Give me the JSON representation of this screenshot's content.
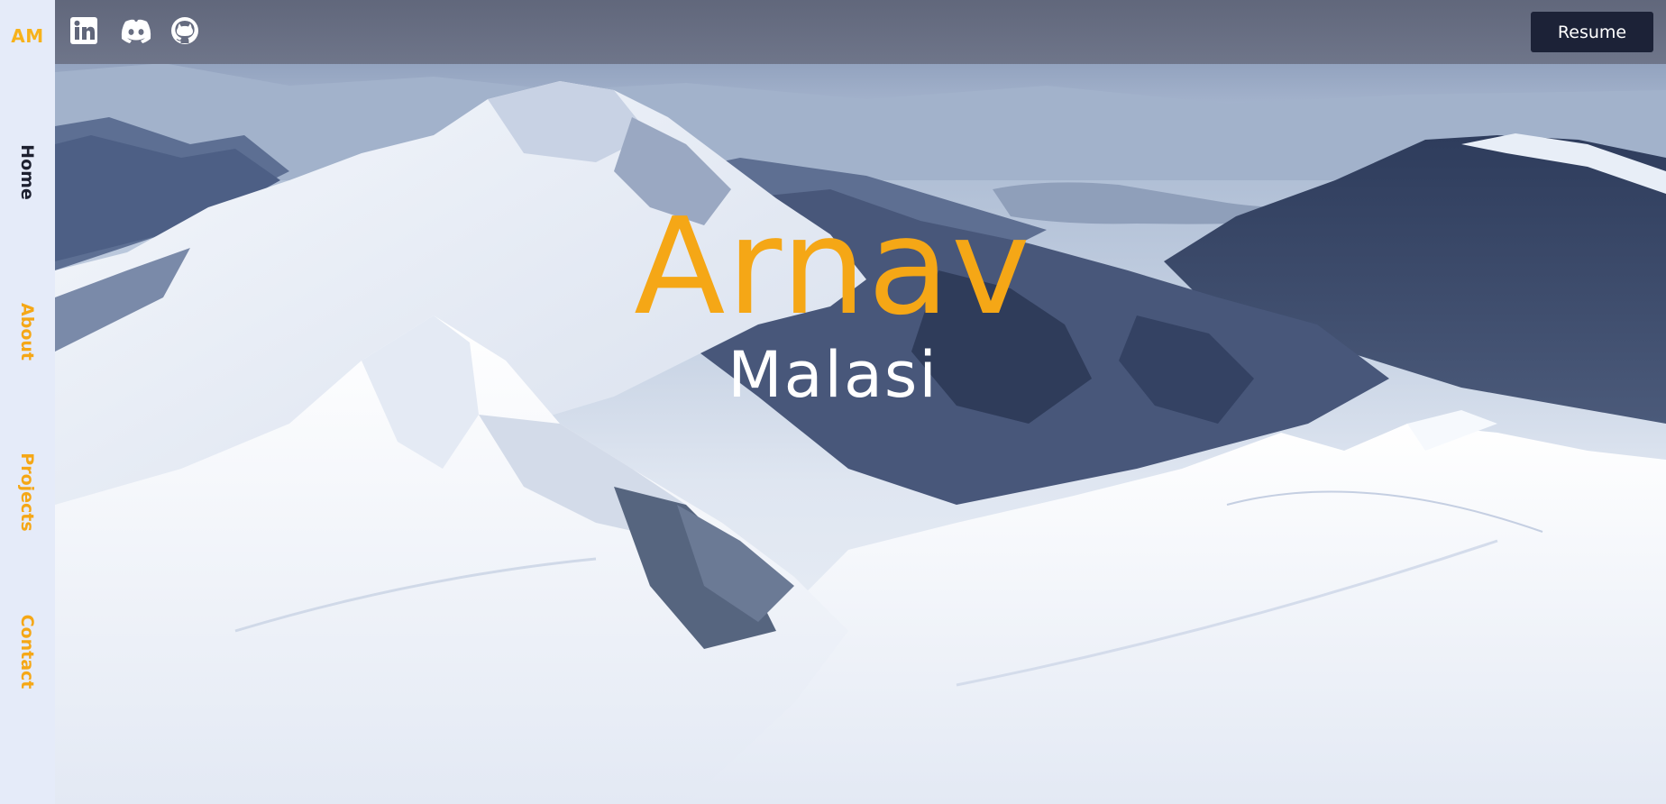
{
  "brand": {
    "logo_text": "AM",
    "accent_color": "#f5a716"
  },
  "social_links": [
    {
      "name": "LinkedIn",
      "icon": "linkedin-icon"
    },
    {
      "name": "Discord",
      "icon": "discord-icon"
    },
    {
      "name": "GitHub",
      "icon": "github-icon"
    }
  ],
  "topbar": {
    "resume_label": "Resume"
  },
  "nav": {
    "items": [
      {
        "label": "Home",
        "active": true
      },
      {
        "label": "About",
        "active": false
      },
      {
        "label": "Projects",
        "active": false
      },
      {
        "label": "Contact",
        "active": false
      }
    ]
  },
  "hero": {
    "first_name": "Arnav",
    "last_name": "Malasi",
    "background": "snowy-mountain-landscape"
  }
}
